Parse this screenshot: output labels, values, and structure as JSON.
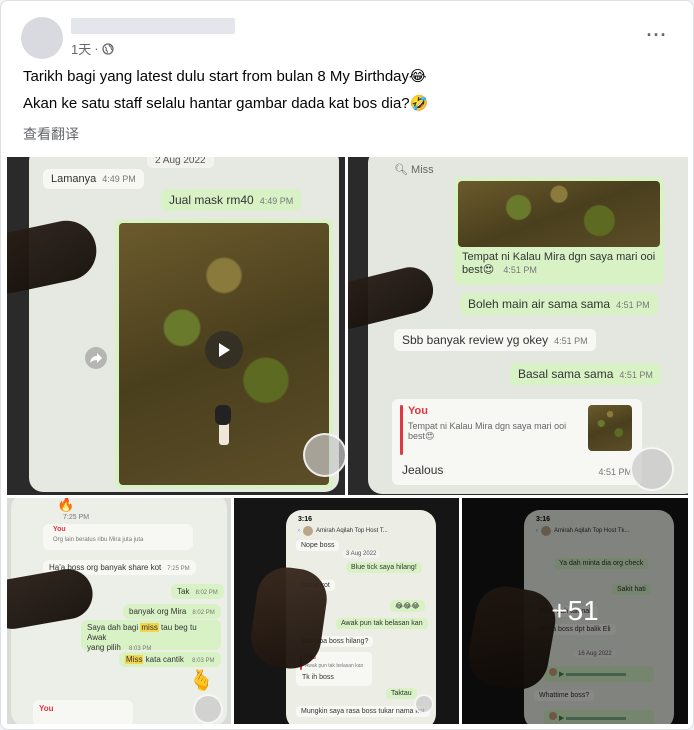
{
  "post": {
    "time": "1天",
    "line1": "Tarikh bagi yang latest dulu start from bulan 8 My Birthday😂",
    "line2": "Akan ke satu staff selalu hantar gambar dada kat bos dia?🤣",
    "see_translation": "查看翻译",
    "more_count": "+51"
  },
  "photo1": {
    "prev_msg": "Lamanya",
    "prev_time": "4:49 PM",
    "date": "2 Aug 2022",
    "msg": "Jual mask rm40",
    "msg_time": "4:49 PM"
  },
  "photo2": {
    "search": "Miss",
    "caption": "Tempat ni Kalau Mira dgn saya mari ooi best😍",
    "caption_time": "4:51 PM",
    "m1": "Boleh main air sama sama",
    "m1_time": "4:51 PM",
    "m2": "Sbb banyak review yg okey",
    "m2_time": "4:51 PM",
    "m3": "Basal sama sama",
    "m3_time": "4:51 PM",
    "reply_you": "You",
    "reply_text": "Tempat ni Kalau Mira dgn saya mari ooi best😍",
    "reply_msg": "Jealous",
    "reply_time": "4:51 PM"
  },
  "photo3": {
    "t1": "7:25 PM",
    "you": "You",
    "quoted": "Org lain beratus ribu Mira juta juta",
    "m1": "Ha'a boss org banyak share kot",
    "m1_time": "7:25 PM",
    "m2": "Tak",
    "m2_time": "8:02 PM",
    "m3": "banyak org Mira",
    "m3_time": "8:02 PM",
    "m4a": "Saya dah bagi ",
    "m4hl": "miss",
    "m4b": " tau beg tu Awak",
    "m4c": "yang pilih",
    "m4_time": "8:03 PM",
    "m5hl": "Miss",
    "m5": " kata cantik",
    "m5_time": "8:03 PM",
    "you2": "You"
  },
  "photo4": {
    "time": "3:16",
    "contact": "Amirah Aqilah Top Host T...",
    "m0": "Nope boss",
    "date": "3 Aug 2022",
    "m1": "Blue tick saya hilang!",
    "m2": "nama kot",
    "m3": "😂😂😂",
    "m4": "Awak pun tak belasan kan",
    "m5": "Sbb apa boss hilang?",
    "you": "You",
    "quoted": "Awak pun tak belasan kan",
    "m6": "Tk ih boss",
    "m7": "Taktau",
    "m8": "Mungkin saya rasa boss tukar nama kot"
  },
  "photo5": {
    "time": "3:16",
    "contact": "Amirah Aqilah Top Host Tk...",
    "m1": "Ya dah minta dia org check",
    "m2": "Sakit hati",
    "m3": "Boss dah tak nak",
    "m4": "Minta boss dpt balik Eli",
    "date": "16 Aug 2022",
    "m5": "Whattime boss?"
  }
}
